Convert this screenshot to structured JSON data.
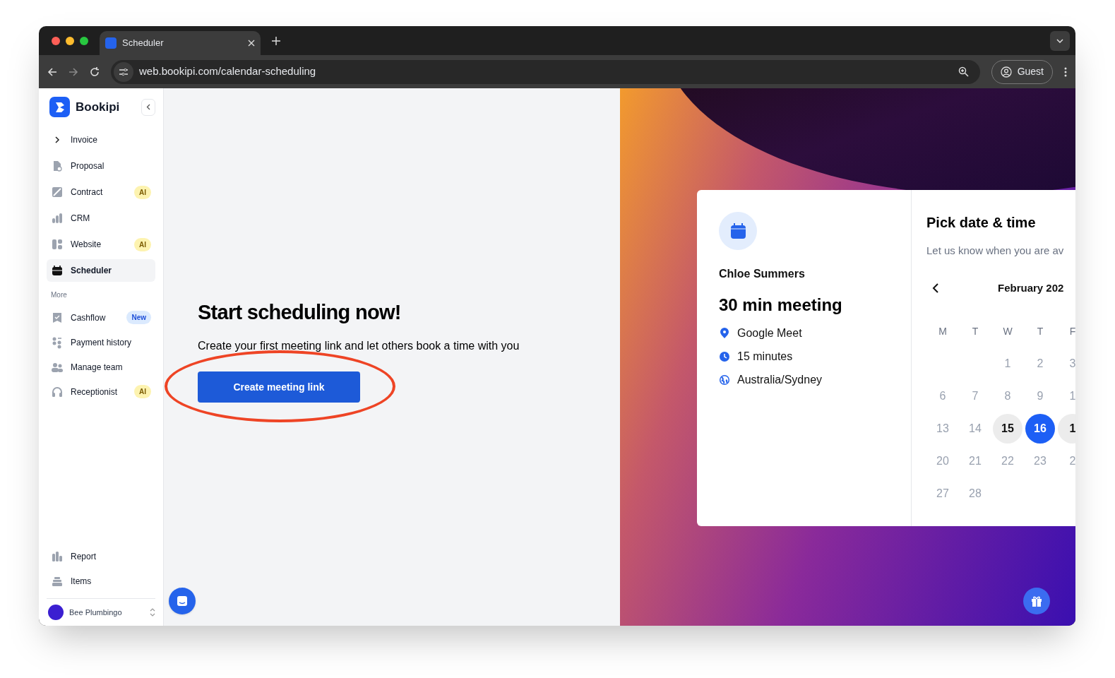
{
  "browser": {
    "tab_title": "Scheduler",
    "url": "web.bookipi.com/calendar-scheduling",
    "profile": "Guest"
  },
  "sidebar": {
    "brand": "Bookipi",
    "items": [
      {
        "label": "Invoice",
        "selected": false
      },
      {
        "label": "Proposal",
        "selected": false
      },
      {
        "label": "Contract",
        "selected": false,
        "badge": {
          "text": "AI",
          "kind": "ai"
        }
      },
      {
        "label": "CRM",
        "selected": false
      },
      {
        "label": "Website",
        "selected": false,
        "badge": {
          "text": "AI",
          "kind": "ai"
        }
      },
      {
        "label": "Scheduler",
        "selected": true
      }
    ],
    "section_label": "More",
    "more_items": [
      {
        "label": "Cashflow",
        "selected": false,
        "badge": {
          "text": "New",
          "kind": "new"
        }
      },
      {
        "label": "Payment history",
        "selected": false
      },
      {
        "label": "Manage team",
        "selected": false
      },
      {
        "label": "Receptionist",
        "selected": false,
        "badge": {
          "text": "AI",
          "kind": "ai"
        }
      }
    ],
    "bottom_items": [
      {
        "label": "Report",
        "selected": false
      },
      {
        "label": "Items",
        "selected": false
      }
    ],
    "account": "Bee Plumbingo"
  },
  "main": {
    "title": "Start scheduling now!",
    "subtitle": "Create your first meeting link and let others book a time with you",
    "button": "Create meeting link"
  },
  "preview": {
    "host": "Chloe Summers",
    "meeting_title": "30 min meeting",
    "details": [
      {
        "kind": "location",
        "text": "Google Meet"
      },
      {
        "kind": "duration",
        "text": "15 minutes"
      },
      {
        "kind": "timezone",
        "text": "Australia/Sydney"
      }
    ],
    "picker_title": "Pick date & time",
    "picker_subtitle": "Let us know when you are av",
    "month": "February 202",
    "weekdays": [
      "M",
      "T",
      "W",
      "T",
      "F"
    ],
    "weeks": [
      [
        {
          "label": "1",
          "selected": false,
          "available": false
        },
        {
          "label": "2",
          "selected": false,
          "available": false
        },
        {
          "label": "3",
          "selected": false,
          "available": false
        }
      ],
      [
        {
          "label": "6",
          "selected": false,
          "available": false
        },
        {
          "label": "7",
          "selected": false,
          "available": false
        },
        {
          "label": "8",
          "selected": false,
          "available": false
        },
        {
          "label": "9",
          "selected": false,
          "available": false
        },
        {
          "label": "1",
          "selected": false,
          "available": false
        }
      ],
      [
        {
          "label": "13",
          "selected": false,
          "available": false
        },
        {
          "label": "14",
          "selected": false,
          "available": false
        },
        {
          "label": "15",
          "selected": false,
          "available": true
        },
        {
          "label": "16",
          "selected": true,
          "available": true
        },
        {
          "label": "1",
          "selected": false,
          "available": true
        }
      ],
      [
        {
          "label": "20",
          "selected": false,
          "available": false
        },
        {
          "label": "21",
          "selected": false,
          "available": false
        },
        {
          "label": "22",
          "selected": false,
          "available": false
        },
        {
          "label": "23",
          "selected": false,
          "available": false
        },
        {
          "label": "2",
          "selected": false,
          "available": false
        }
      ],
      [
        {
          "label": "27",
          "selected": false,
          "available": false
        },
        {
          "label": "28",
          "selected": false,
          "available": false
        }
      ]
    ]
  }
}
